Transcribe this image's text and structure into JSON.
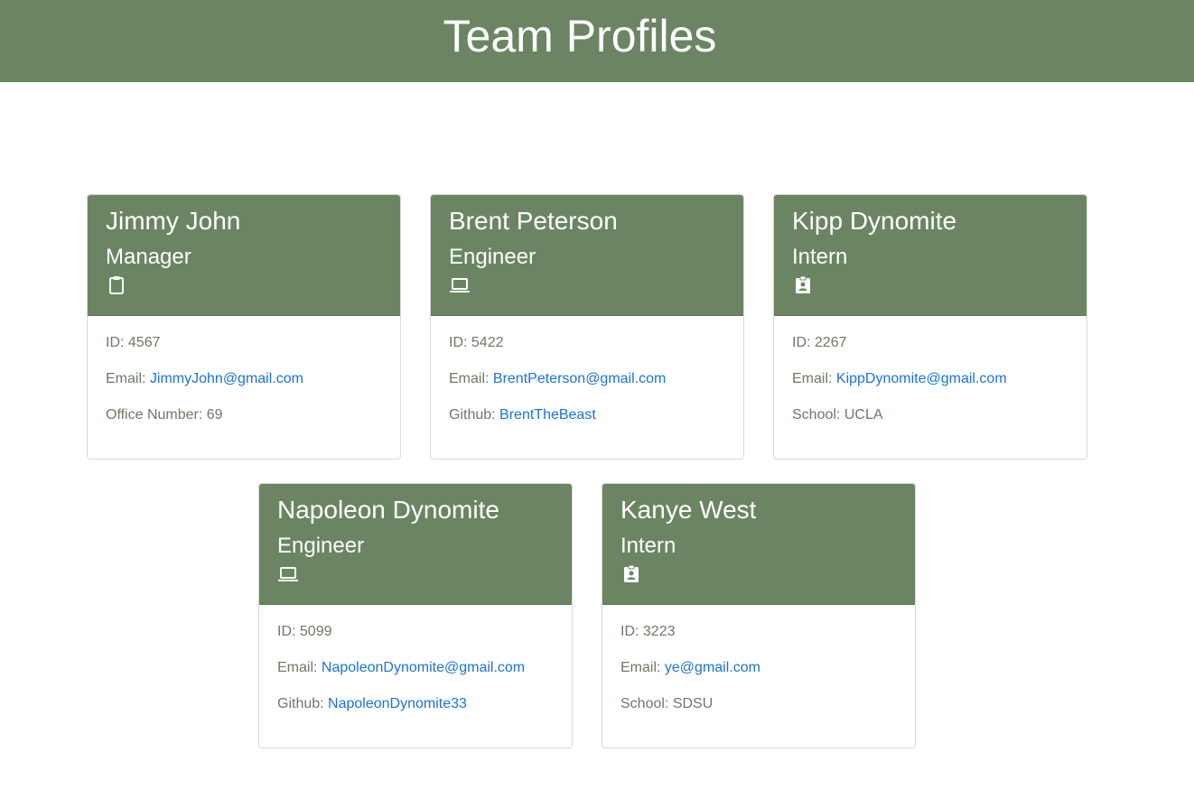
{
  "header": {
    "title": "Team Profiles"
  },
  "colors": {
    "accent": "#6b8563",
    "link": "#1a73d9",
    "text": "#6b7a66"
  },
  "cards": [
    {
      "name": "Jimmy John",
      "role": "Manager",
      "icon": "clipboard-icon",
      "id_label": "ID:",
      "id": "4567",
      "email_label": "Email:",
      "email": "JimmyJohn@gmail.com",
      "extra_label": "Office Number:",
      "extra_value": "69"
    },
    {
      "name": "Brent Peterson",
      "role": "Engineer",
      "icon": "laptop-icon",
      "id_label": "ID:",
      "id": "5422",
      "email_label": "Email:",
      "email": "BrentPeterson@gmail.com",
      "extra_label": "Github:",
      "extra_value": "BrentTheBeast"
    },
    {
      "name": "Kipp Dynomite",
      "role": "Intern",
      "icon": "id-badge-icon",
      "id_label": "ID:",
      "id": "2267",
      "email_label": "Email:",
      "email": "KippDynomite@gmail.com",
      "extra_label": "School:",
      "extra_value": "UCLA"
    },
    {
      "name": "Napoleon Dynomite",
      "role": "Engineer",
      "icon": "laptop-icon",
      "id_label": "ID:",
      "id": "5099",
      "email_label": "Email:",
      "email": "NapoleonDynomite@gmail.com",
      "extra_label": "Github:",
      "extra_value": "NapoleonDynomite33"
    },
    {
      "name": "Kanye West",
      "role": "Intern",
      "icon": "id-badge-icon",
      "id_label": "ID:",
      "id": "3223",
      "email_label": "Email:",
      "email": "ye@gmail.com",
      "extra_label": "School:",
      "extra_value": "SDSU"
    }
  ]
}
